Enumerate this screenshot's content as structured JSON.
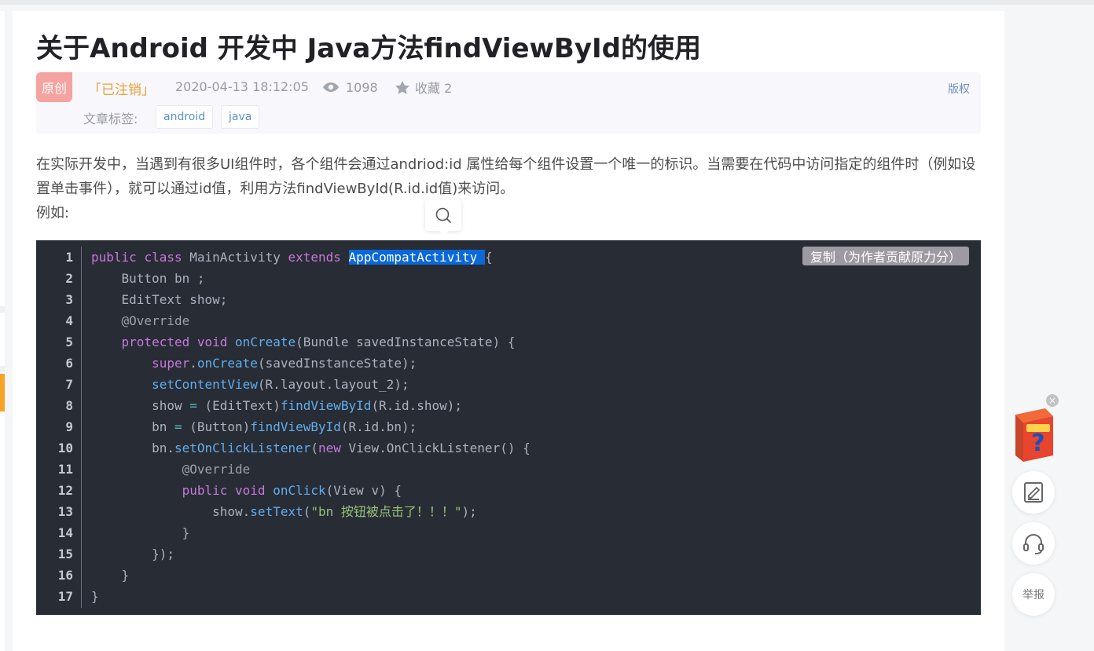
{
  "article": {
    "title": "关于Android 开发中 Java方法findViewById的使用",
    "badge": "原创",
    "author": "「已注销」",
    "date": "2020-04-13 18:12:05",
    "views": "1098",
    "favorites": "收藏 2",
    "copyright": "版权",
    "tags_label": "文章标签:",
    "tags": [
      "android",
      "java"
    ],
    "paragraph": "在实际开发中，当遇到有很多UI组件时，各个组件会通过andriod:id 属性给每个组件设置一个唯一的标识。当需要在代码中访问指定的组件时（例如设置单击事件），就可以通过id值，利用方法findViewById(R.id.id值)来访问。",
    "paragraph2": "例如:"
  },
  "code": {
    "copy_label": "复制（为作者贡献原力分）",
    "line_numbers": [
      "1",
      "2",
      "3",
      "4",
      "5",
      "6",
      "7",
      "8",
      "9",
      "10",
      "11",
      "12",
      "13",
      "14",
      "15",
      "16",
      "17"
    ],
    "lines": [
      "public class MainActivity extends AppCompatActivity {",
      "    Button bn ;",
      "    EditText show;",
      "    @Override",
      "    protected void onCreate(Bundle savedInstanceState) {",
      "        super.onCreate(savedInstanceState);",
      "        setContentView(R.layout.layout_2);",
      "        show = (EditText)findViewById(R.id.show);",
      "        bn = (Button)findViewById(R.id.bn);",
      "        bn.setOnClickListener(new View.OnClickListener() {",
      "            @Override",
      "            public void onClick(View v) {",
      "                show.setText(\"bn 按钮被点击了！！！\");",
      "            }",
      "        });",
      "    }",
      "}"
    ],
    "selected_text": "AppCompatActivity"
  },
  "sidebar": {
    "report_label": "举报",
    "icons": [
      "promo-box-icon",
      "note-edit-icon",
      "headset-icon"
    ]
  },
  "colors": {
    "code_bg": "#282c34",
    "keyword": "#c678dd",
    "function": "#61aeee",
    "string": "#98c379",
    "selection": "#0a68d8",
    "author": "#e8a23a",
    "badge": "#f4a3a0"
  }
}
